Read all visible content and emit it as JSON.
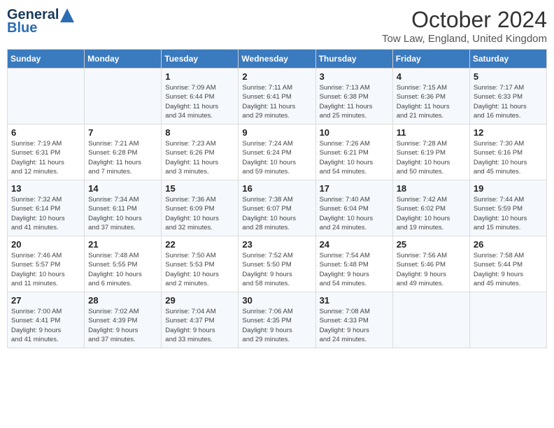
{
  "header": {
    "logo_line1": "General",
    "logo_line2": "Blue",
    "month": "October 2024",
    "location": "Tow Law, England, United Kingdom"
  },
  "days_of_week": [
    "Sunday",
    "Monday",
    "Tuesday",
    "Wednesday",
    "Thursday",
    "Friday",
    "Saturday"
  ],
  "weeks": [
    [
      {
        "day": "",
        "info": ""
      },
      {
        "day": "",
        "info": ""
      },
      {
        "day": "1",
        "info": "Sunrise: 7:09 AM\nSunset: 6:44 PM\nDaylight: 11 hours\nand 34 minutes."
      },
      {
        "day": "2",
        "info": "Sunrise: 7:11 AM\nSunset: 6:41 PM\nDaylight: 11 hours\nand 29 minutes."
      },
      {
        "day": "3",
        "info": "Sunrise: 7:13 AM\nSunset: 6:38 PM\nDaylight: 11 hours\nand 25 minutes."
      },
      {
        "day": "4",
        "info": "Sunrise: 7:15 AM\nSunset: 6:36 PM\nDaylight: 11 hours\nand 21 minutes."
      },
      {
        "day": "5",
        "info": "Sunrise: 7:17 AM\nSunset: 6:33 PM\nDaylight: 11 hours\nand 16 minutes."
      }
    ],
    [
      {
        "day": "6",
        "info": "Sunrise: 7:19 AM\nSunset: 6:31 PM\nDaylight: 11 hours\nand 12 minutes."
      },
      {
        "day": "7",
        "info": "Sunrise: 7:21 AM\nSunset: 6:28 PM\nDaylight: 11 hours\nand 7 minutes."
      },
      {
        "day": "8",
        "info": "Sunrise: 7:23 AM\nSunset: 6:26 PM\nDaylight: 11 hours\nand 3 minutes."
      },
      {
        "day": "9",
        "info": "Sunrise: 7:24 AM\nSunset: 6:24 PM\nDaylight: 10 hours\nand 59 minutes."
      },
      {
        "day": "10",
        "info": "Sunrise: 7:26 AM\nSunset: 6:21 PM\nDaylight: 10 hours\nand 54 minutes."
      },
      {
        "day": "11",
        "info": "Sunrise: 7:28 AM\nSunset: 6:19 PM\nDaylight: 10 hours\nand 50 minutes."
      },
      {
        "day": "12",
        "info": "Sunrise: 7:30 AM\nSunset: 6:16 PM\nDaylight: 10 hours\nand 45 minutes."
      }
    ],
    [
      {
        "day": "13",
        "info": "Sunrise: 7:32 AM\nSunset: 6:14 PM\nDaylight: 10 hours\nand 41 minutes."
      },
      {
        "day": "14",
        "info": "Sunrise: 7:34 AM\nSunset: 6:11 PM\nDaylight: 10 hours\nand 37 minutes."
      },
      {
        "day": "15",
        "info": "Sunrise: 7:36 AM\nSunset: 6:09 PM\nDaylight: 10 hours\nand 32 minutes."
      },
      {
        "day": "16",
        "info": "Sunrise: 7:38 AM\nSunset: 6:07 PM\nDaylight: 10 hours\nand 28 minutes."
      },
      {
        "day": "17",
        "info": "Sunrise: 7:40 AM\nSunset: 6:04 PM\nDaylight: 10 hours\nand 24 minutes."
      },
      {
        "day": "18",
        "info": "Sunrise: 7:42 AM\nSunset: 6:02 PM\nDaylight: 10 hours\nand 19 minutes."
      },
      {
        "day": "19",
        "info": "Sunrise: 7:44 AM\nSunset: 5:59 PM\nDaylight: 10 hours\nand 15 minutes."
      }
    ],
    [
      {
        "day": "20",
        "info": "Sunrise: 7:46 AM\nSunset: 5:57 PM\nDaylight: 10 hours\nand 11 minutes."
      },
      {
        "day": "21",
        "info": "Sunrise: 7:48 AM\nSunset: 5:55 PM\nDaylight: 10 hours\nand 6 minutes."
      },
      {
        "day": "22",
        "info": "Sunrise: 7:50 AM\nSunset: 5:53 PM\nDaylight: 10 hours\nand 2 minutes."
      },
      {
        "day": "23",
        "info": "Sunrise: 7:52 AM\nSunset: 5:50 PM\nDaylight: 9 hours\nand 58 minutes."
      },
      {
        "day": "24",
        "info": "Sunrise: 7:54 AM\nSunset: 5:48 PM\nDaylight: 9 hours\nand 54 minutes."
      },
      {
        "day": "25",
        "info": "Sunrise: 7:56 AM\nSunset: 5:46 PM\nDaylight: 9 hours\nand 49 minutes."
      },
      {
        "day": "26",
        "info": "Sunrise: 7:58 AM\nSunset: 5:44 PM\nDaylight: 9 hours\nand 45 minutes."
      }
    ],
    [
      {
        "day": "27",
        "info": "Sunrise: 7:00 AM\nSunset: 4:41 PM\nDaylight: 9 hours\nand 41 minutes."
      },
      {
        "day": "28",
        "info": "Sunrise: 7:02 AM\nSunset: 4:39 PM\nDaylight: 9 hours\nand 37 minutes."
      },
      {
        "day": "29",
        "info": "Sunrise: 7:04 AM\nSunset: 4:37 PM\nDaylight: 9 hours\nand 33 minutes."
      },
      {
        "day": "30",
        "info": "Sunrise: 7:06 AM\nSunset: 4:35 PM\nDaylight: 9 hours\nand 29 minutes."
      },
      {
        "day": "31",
        "info": "Sunrise: 7:08 AM\nSunset: 4:33 PM\nDaylight: 9 hours\nand 24 minutes."
      },
      {
        "day": "",
        "info": ""
      },
      {
        "day": "",
        "info": ""
      }
    ]
  ]
}
